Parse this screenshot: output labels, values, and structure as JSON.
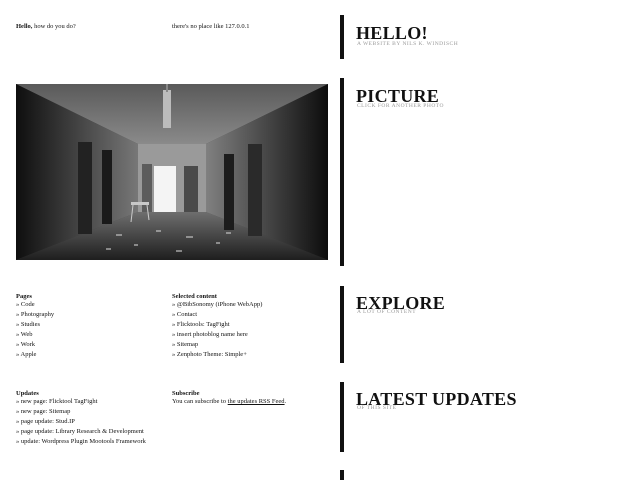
{
  "greeting": {
    "bold": "Hello,",
    "rest": " how do you do?"
  },
  "localhost_text": "there's no place like 127.0.0.1",
  "sections": [
    {
      "title": "HELLO!",
      "subtitle": "A WEBSITE BY NILS K. WINDISCH"
    },
    {
      "title": "PICTURE",
      "subtitle": "CLICK FOR ANOTHER PHOTO"
    },
    {
      "title": "EXPLORE",
      "subtitle": "A LOT OF CONTENT"
    },
    {
      "title": "LATEST UPDATES",
      "subtitle": "OF THIS SITE"
    }
  ],
  "pages": {
    "title": "Pages",
    "items": [
      "» Code",
      "» Photography",
      "» Studies",
      "» Web",
      "» Work",
      "» Apple"
    ]
  },
  "selected": {
    "title": "Selected content",
    "items": [
      "» @BibSonomy (iPhone WebApp)",
      "» Contact",
      "» Flicktools: TagFight",
      "» insert photoblog name here",
      "» Sitemap",
      "» Zenphoto Theme: Simple+"
    ]
  },
  "updates": {
    "title": "Updates",
    "items": [
      "» new page: Flicktool TagFight",
      "» new page: Sitemap",
      "» page update: Stud.IP",
      "» page update: Library Research & Development",
      "» update: Wordpress Plugin Mootools Framework"
    ]
  },
  "subscribe": {
    "title": "Subscribe",
    "prefix": "You can subscribe to ",
    "link": "the updates RSS Feed",
    "suffix": "."
  },
  "colors": {
    "bar": "#111111",
    "subtitle": "#9a9a9a"
  }
}
